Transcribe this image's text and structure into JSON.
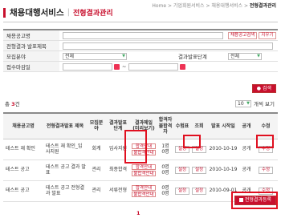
{
  "breadcrumb": {
    "home": "Home",
    "path1": "기업회원서비스",
    "path2": "채용대행서비스",
    "current": "전형결과관리"
  },
  "header": {
    "title": "채용대행서비스",
    "sub": "전형결과관리"
  },
  "form": {
    "job_label": "채용공고명",
    "job_btn": "채용공고검색",
    "job_reset": "지우기",
    "result_title_label": "전형결과 발표제목",
    "field_label": "모집분야",
    "field_value": "전체",
    "stage_label": "결과발표단계",
    "stage_value": "전체",
    "date_label": "접수마감일",
    "date_sep": "~"
  },
  "search_btn": "검색",
  "list": {
    "total_prefix": "총",
    "total_count": "3",
    "total_suffix": "건",
    "page_size": "10",
    "page_size_label": "개씩 보기"
  },
  "table": {
    "headers": [
      "채용공고명",
      "전형결과발표 제목",
      "모집분야",
      "결과발표 단계",
      "결과메일 (미리보기)",
      "합격자 불합격자",
      "수험표",
      "조회",
      "발표 시작일",
      "공개",
      "수정"
    ],
    "rows": [
      {
        "job": "테스트 재 확인",
        "title": "테스트 재 확인_입사지원",
        "field": "회계",
        "stage": "입사지원",
        "pass_mail": "합격안내",
        "fail_mail": "불합격안내",
        "pass": "1명",
        "fail": "0명",
        "ticket": "설정",
        "view": "설정",
        "date": "2010-10-19",
        "open": "공개",
        "edit": "수정"
      },
      {
        "job": "테스트 공고",
        "title": "테스트 공고 결과 발표",
        "field": "관리",
        "stage": "최종합격",
        "pass_mail": "합격안내",
        "fail_mail": "불합격안내",
        "pass": "0명",
        "fail": "0명",
        "ticket": "설정",
        "view": "설정",
        "date": "2010-10-19",
        "open": "공개",
        "edit": "수정"
      },
      {
        "job": "테스트 공고",
        "title": "테스트 공고 전형결과 발표",
        "field": "관리",
        "stage": "서류전형",
        "pass_mail": "합격안내",
        "fail_mail": "불합격안내",
        "pass": "0명",
        "fail": "0명",
        "ticket": "설정",
        "view": "설정",
        "date": "2010-09-01",
        "open": "공개",
        "edit": "수정"
      }
    ]
  },
  "register_btn": "전형결과등록",
  "pagination": {
    "current": "1"
  },
  "colors": {
    "accent": "#c8102e",
    "highlight": "#e01020"
  }
}
